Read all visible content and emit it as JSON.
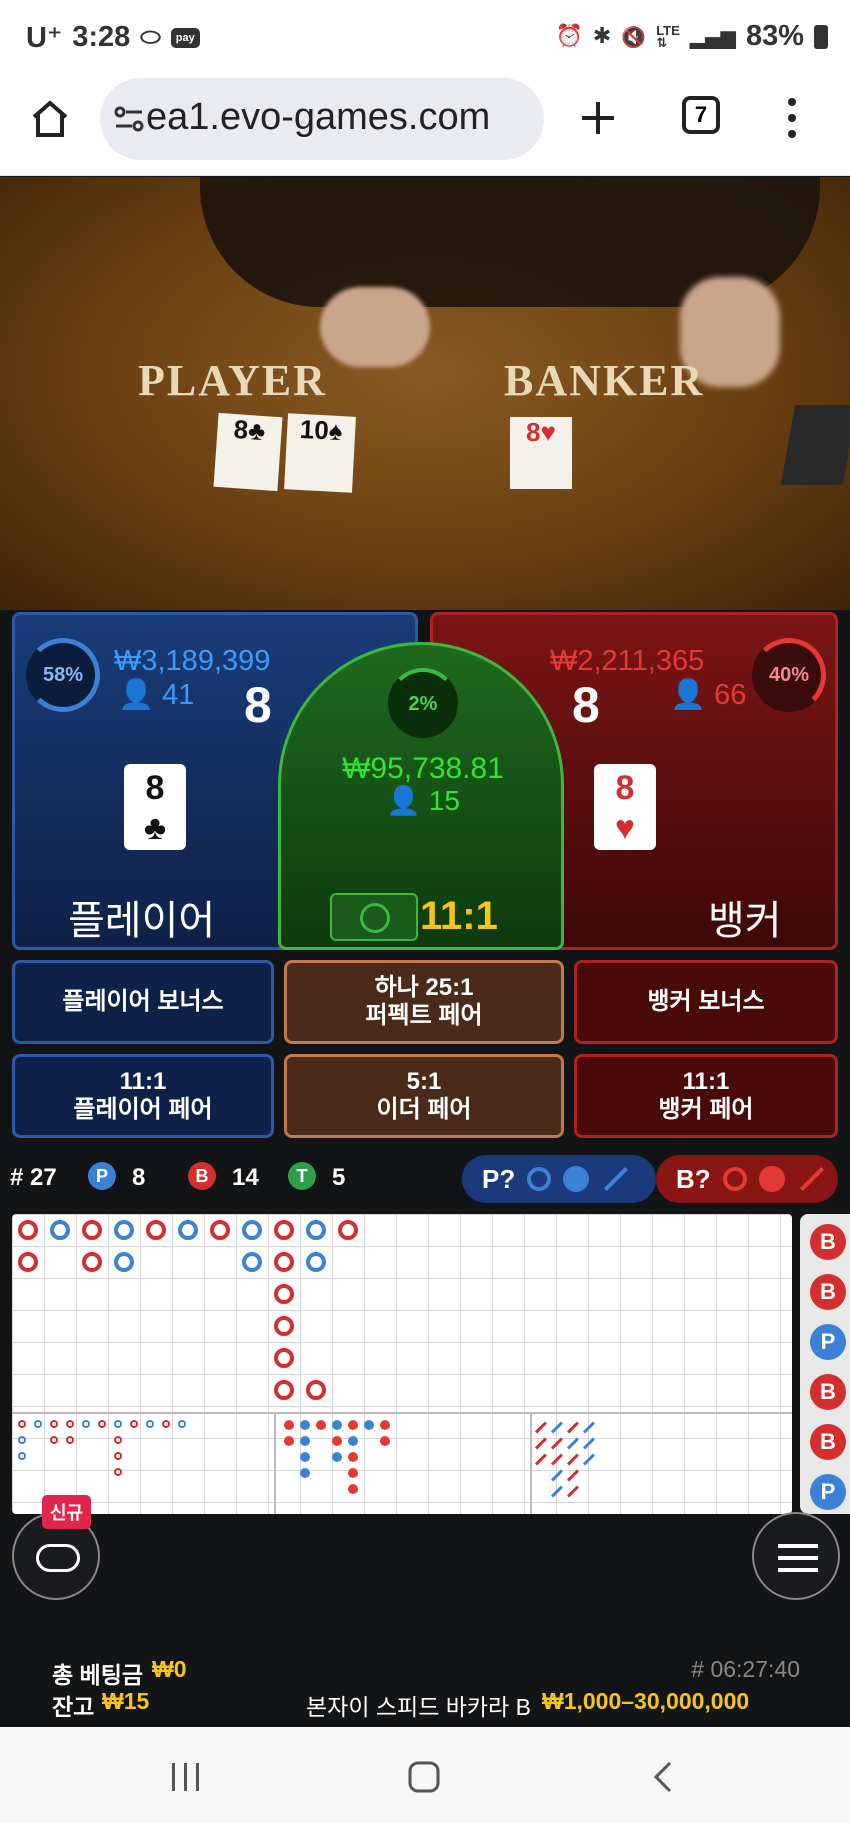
{
  "status_bar": {
    "carrier": "U⁺",
    "time": "3:28",
    "battery": "83%",
    "pay": "pay"
  },
  "browser": {
    "url": "ea1.evo-games.com",
    "tabs": "7"
  },
  "table": {
    "player_label": "PLAYER",
    "banker_label": "BANKER"
  },
  "player": {
    "percent": "58%",
    "amount": "₩3,189,399",
    "bettors": "41",
    "score": "8",
    "card_rank": "8",
    "card_suit": "♣",
    "name": "플레이어"
  },
  "banker": {
    "percent": "40%",
    "amount": "₩2,211,365",
    "bettors": "66",
    "score": "8",
    "card_rank": "8",
    "card_suit": "♥",
    "name": "뱅커"
  },
  "tie": {
    "percent": "2%",
    "amount": "₩95,738.81",
    "bettors": "15",
    "odds": "11:1"
  },
  "buttons": {
    "player_bonus": "플레이어 보너스",
    "perfect_odds": "하나 25:1",
    "perfect_label": "퍼펙트 페어",
    "banker_bonus": "뱅커 보너스",
    "player_pair_odds": "11:1",
    "player_pair": "플레이어 페어",
    "either_odds": "5:1",
    "either_pair": "이더 페어",
    "banker_pair_odds": "11:1",
    "banker_pair": "뱅커 페어"
  },
  "stats": {
    "round": "# 27",
    "p_label": "P",
    "p_count": "8",
    "b_label": "B",
    "b_count": "14",
    "t_label": "T",
    "t_count": "5",
    "p_predict": "P?",
    "b_predict": "B?"
  },
  "road_side": [
    "B",
    "B",
    "P",
    "B",
    "B",
    "P"
  ],
  "badge_new": "신규",
  "footer": {
    "total_bet_label": "총 베팅금",
    "total_bet": "₩0",
    "balance_label": "잔고",
    "balance": "₩15",
    "round_id": "# 06:27:40",
    "table_name": "본자이 스피드 바카라 B",
    "limits": "₩1,000–30,000,000"
  },
  "colors": {
    "player": "#3b82d6",
    "banker": "#d32f2f",
    "tie": "#3cb83c",
    "gold": "#f5c518"
  }
}
